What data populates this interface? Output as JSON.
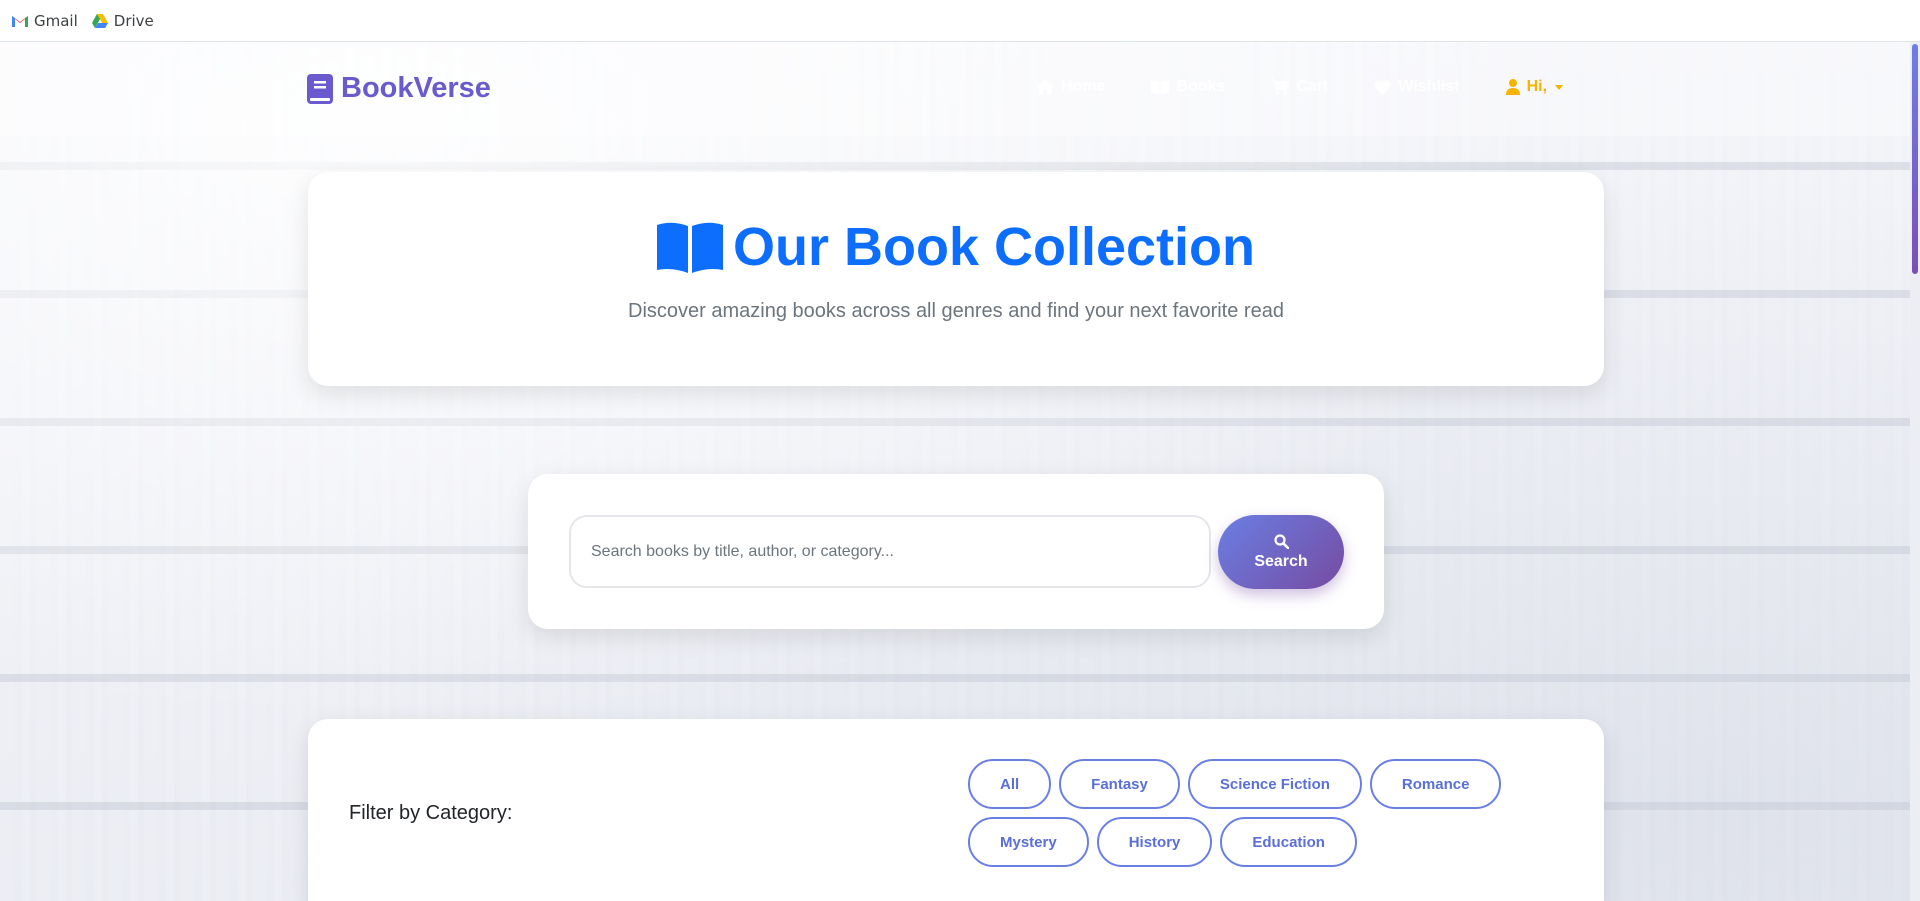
{
  "bookmarks": [
    {
      "label": "Gmail",
      "icon": "gmail-icon"
    },
    {
      "label": "Drive",
      "icon": "drive-icon"
    }
  ],
  "navbar": {
    "brand": "BookVerse",
    "links": [
      {
        "label": "Home",
        "icon": "home-icon"
      },
      {
        "label": "Books",
        "icon": "open-book-icon",
        "active": true
      },
      {
        "label": "Cart",
        "icon": "cart-icon"
      },
      {
        "label": "Wishlist",
        "icon": "heart-icon"
      }
    ],
    "user_greeting": "Hi,"
  },
  "hero": {
    "title": "Our Book Collection",
    "subtitle": "Discover amazing books across all genres and find your next favorite read"
  },
  "search": {
    "placeholder": "Search books by title, author, or category...",
    "value": "",
    "button_label": "Search"
  },
  "filter": {
    "label": "Filter by Category:",
    "categories": [
      "All",
      "Fantasy",
      "Science Fiction",
      "Romance",
      "Mystery",
      "History",
      "Education"
    ]
  },
  "colors": {
    "brand": "#6a5acd",
    "title": "#0d6efd",
    "accent_gradient_start": "#6a7fe3",
    "accent_gradient_end": "#764ba2",
    "user": "#f4b400"
  }
}
